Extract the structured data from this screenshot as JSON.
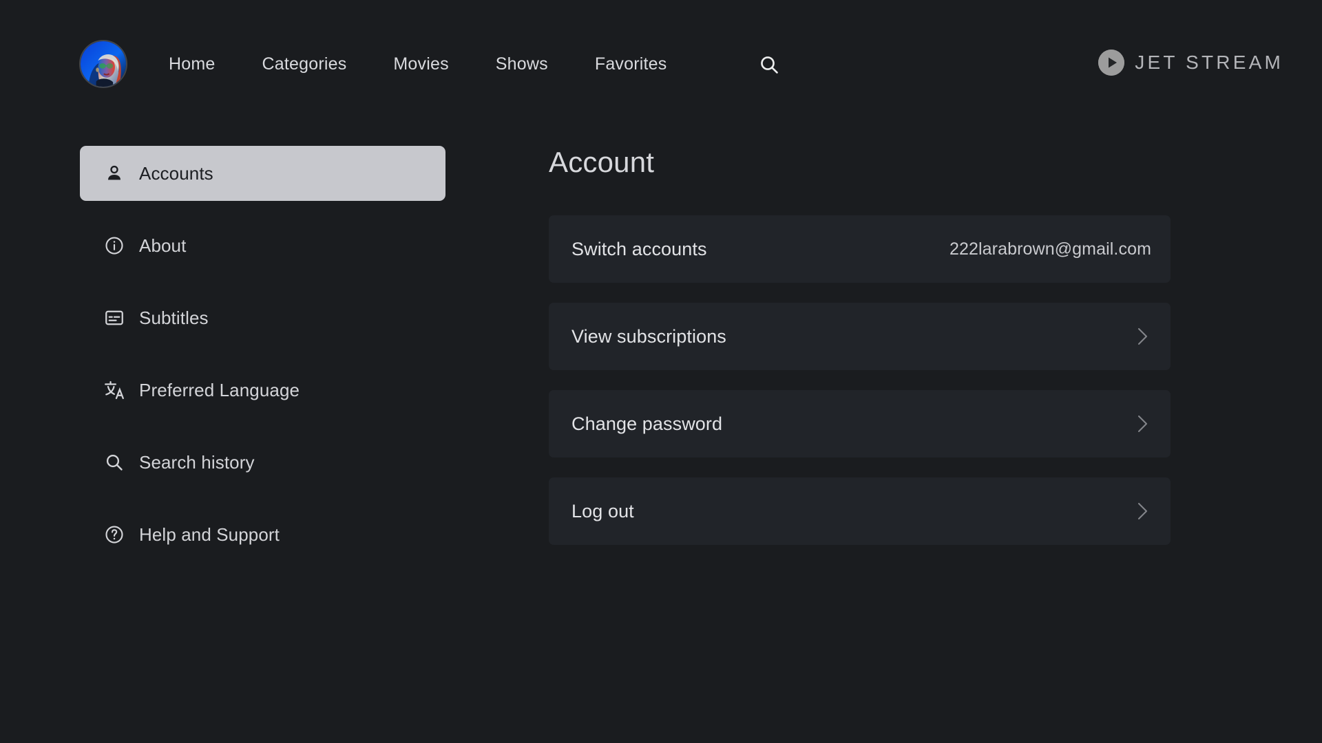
{
  "brand": {
    "name": "JET STREAM",
    "logo_icon": "play-circle-icon",
    "logo_color": "#9c9c9c"
  },
  "nav": {
    "avatar_icon": "user-avatar-portrait",
    "search_icon": "search-icon",
    "items": [
      {
        "label": "Home"
      },
      {
        "label": "Categories"
      },
      {
        "label": "Movies"
      },
      {
        "label": "Shows"
      },
      {
        "label": "Favorites"
      }
    ]
  },
  "sidebar": {
    "items": [
      {
        "label": "Accounts",
        "icon": "person-icon",
        "active": true
      },
      {
        "label": "About",
        "icon": "info-circle-icon",
        "active": false
      },
      {
        "label": "Subtitles",
        "icon": "closed-caption-icon",
        "active": false
      },
      {
        "label": "Preferred Language",
        "icon": "translate-icon",
        "active": false
      },
      {
        "label": "Search history",
        "icon": "search-icon",
        "active": false
      },
      {
        "label": "Help and Support",
        "icon": "question-circle-icon",
        "active": false
      }
    ],
    "active_bg": "#c7c8cd"
  },
  "main": {
    "title": "Account",
    "rows": [
      {
        "label": "Switch accounts",
        "value": "222larabrown@gmail.com",
        "chevron": false
      },
      {
        "label": "View subscriptions",
        "value": "",
        "chevron": true
      },
      {
        "label": "Change password",
        "value": "",
        "chevron": true
      },
      {
        "label": "Log out",
        "value": "",
        "chevron": true
      }
    ],
    "row_bg": "#212429"
  },
  "theme": {
    "page_bg": "#1a1c1f",
    "text_primary": "#e2e3e6",
    "text_secondary": "#c9cace"
  }
}
